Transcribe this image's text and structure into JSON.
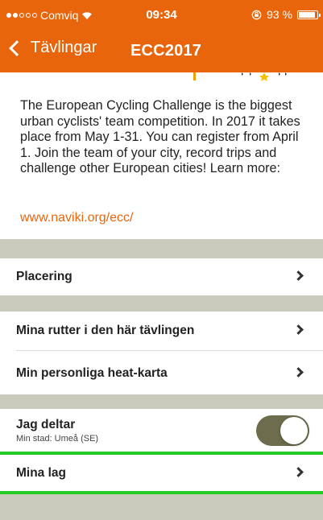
{
  "status_bar": {
    "carrier": "Comviq",
    "time": "09:34",
    "battery": "93 %",
    "battery_level": 0.93
  },
  "nav": {
    "back_label": "Tävlingar",
    "title": "ECC2017"
  },
  "description": "The European Cycling Challenge is the biggest urban cyclists' team competition. In 2017 it takes place from May 1-31. You can register from April 1. Join the team of your city, record trips and challenge other European cities! Learn more:",
  "link": "www.naviki.org/ecc/",
  "rows": {
    "placering": "Placering",
    "mina_rutter": "Mina rutter i den här tävlingen",
    "heat_karta": "Min personliga heat-karta",
    "jag_deltar": "Jag deltar",
    "min_stad": "Min stad: Umeå (SE)",
    "mina_lag": "Mina lag"
  },
  "toggle_on": true,
  "colors": {
    "accent": "#e8650c",
    "separator": "#cbcbbd",
    "toggle": "#6d6c4c",
    "highlight": "#22cc22"
  }
}
